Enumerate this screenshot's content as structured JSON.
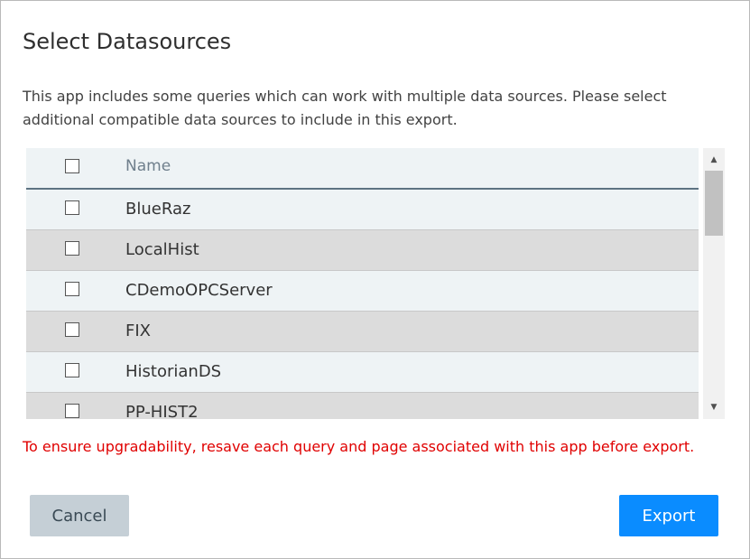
{
  "dialog": {
    "title": "Select Datasources",
    "description": "This app includes some queries which can work with multiple data sources. Please select additional compatible data sources to include in this export."
  },
  "table": {
    "header": "Name",
    "rows": [
      {
        "name": "BlueRaz"
      },
      {
        "name": "LocalHist"
      },
      {
        "name": "CDemoOPCServer"
      },
      {
        "name": "FIX"
      },
      {
        "name": "HistorianDS"
      },
      {
        "name": "PP-HIST2"
      }
    ]
  },
  "scrollbar": {
    "up_icon": "triangle-up-icon",
    "down_icon": "triangle-down-icon"
  },
  "warning": "To ensure upgradability, resave each query and page associated with this app before export.",
  "buttons": {
    "cancel": "Cancel",
    "export": "Export"
  },
  "colors": {
    "warning": "#e00000",
    "export_bg": "#0a8cff",
    "cancel_bg": "#c5cfd6",
    "row_odd": "#eef3f5",
    "row_even": "#dcdcdc"
  }
}
